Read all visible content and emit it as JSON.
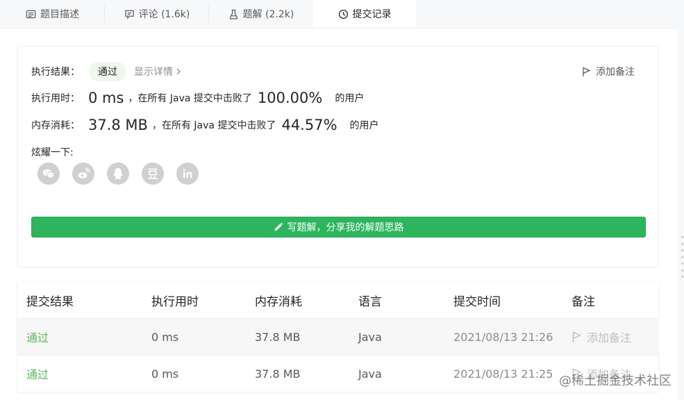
{
  "tabs": [
    {
      "label": "题目描述",
      "icon": "description-icon"
    },
    {
      "label": "评论 (1.6k)",
      "icon": "comment-icon"
    },
    {
      "label": "题解 (2.2k)",
      "icon": "flask-icon"
    },
    {
      "label": "提交记录",
      "icon": "clock-icon"
    }
  ],
  "result": {
    "status_label": "执行结果：",
    "status_value": "通过",
    "details_link": "显示详情",
    "add_note": "添加备注",
    "runtime_label": "执行用时：",
    "runtime_value": "0 ms",
    "runtime_beat_prefix": "，在所有 Java 提交中击败了",
    "runtime_percent": "100.00%",
    "runtime_suffix": "的用户",
    "memory_label": "内存消耗：",
    "memory_value": "37.8 MB",
    "memory_beat_prefix": "，在所有 Java 提交中击败了",
    "memory_percent": "44.57%",
    "memory_suffix": "的用户",
    "share_label": "炫耀一下:",
    "share_icons": [
      "wechat-icon",
      "weibo-icon",
      "qq-icon",
      "douban-icon",
      "linkedin-icon"
    ],
    "write_button": "写题解，分享我的解题思路"
  },
  "table": {
    "headers": [
      "提交结果",
      "执行用时",
      "内存消耗",
      "语言",
      "提交时间",
      "备注"
    ],
    "rows": [
      {
        "result": "通过",
        "runtime": "0 ms",
        "memory": "37.8 MB",
        "language": "Java",
        "time": "2021/08/13 21:26",
        "note": "添加备注"
      },
      {
        "result": "通过",
        "runtime": "0 ms",
        "memory": "37.8 MB",
        "language": "Java",
        "time": "2021/08/13 21:25",
        "note": "添加备注"
      }
    ]
  },
  "watermark": "@稀土掘金技术社区",
  "colors": {
    "accent_green": "#2db55d",
    "pass_green": "#5cb85c"
  }
}
